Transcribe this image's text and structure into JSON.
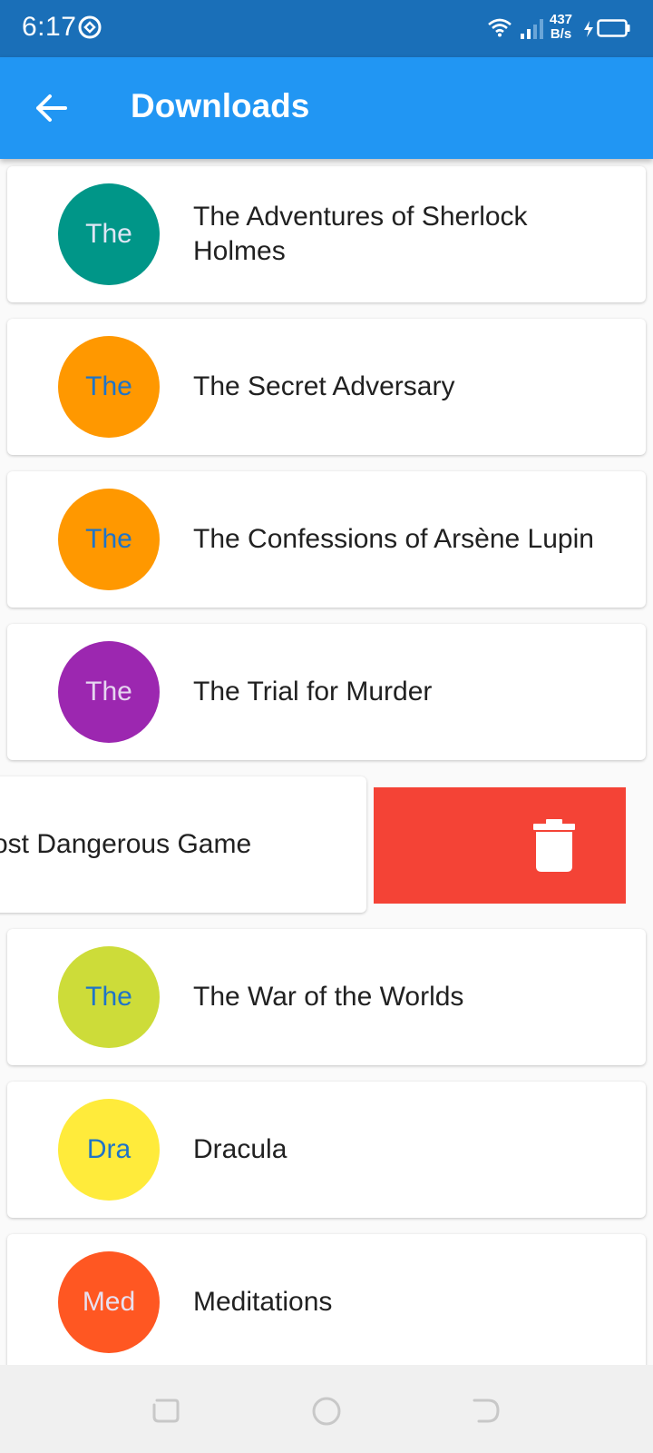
{
  "status_bar": {
    "time": "6:17",
    "net_speed_value": "437",
    "net_speed_unit": "B/s"
  },
  "app_bar": {
    "title": "Downloads",
    "back_icon": "arrow-back-icon"
  },
  "books": [
    {
      "initials": "The",
      "title": "The Adventures of Sherlock Holmes",
      "avatar_color": "#009688",
      "initials_color": "#dfe6f5"
    },
    {
      "initials": "The",
      "title": "The Secret Adversary",
      "avatar_color": "#ff9800",
      "initials_color": "#1e74c8"
    },
    {
      "initials": "The",
      "title": "The Confessions of Arsène Lupin",
      "avatar_color": "#ff9800",
      "initials_color": "#1e74c8"
    },
    {
      "initials": "The",
      "title": "The Trial for Murder",
      "avatar_color": "#9c27b0",
      "initials_color": "#e6d6f0"
    },
    {
      "initials": "",
      "title": "ost Dangerous Game",
      "avatar_color": "",
      "initials_color": ""
    },
    {
      "initials": "The",
      "title": "The War of the Worlds",
      "avatar_color": "#cddc39",
      "initials_color": "#1e74c8"
    },
    {
      "initials": "Dra",
      "title": "Dracula",
      "avatar_color": "#ffeb3b",
      "initials_color": "#1e74c8"
    },
    {
      "initials": "Med",
      "title": "Meditations",
      "avatar_color": "#ff5722",
      "initials_color": "#e8e0f0"
    }
  ],
  "swipe": {
    "delete_color": "#f44336",
    "delete_icon": "trash-icon"
  },
  "nav": {
    "recents_icon": "recents-icon",
    "home_icon": "home-icon",
    "back_icon": "back-icon"
  }
}
